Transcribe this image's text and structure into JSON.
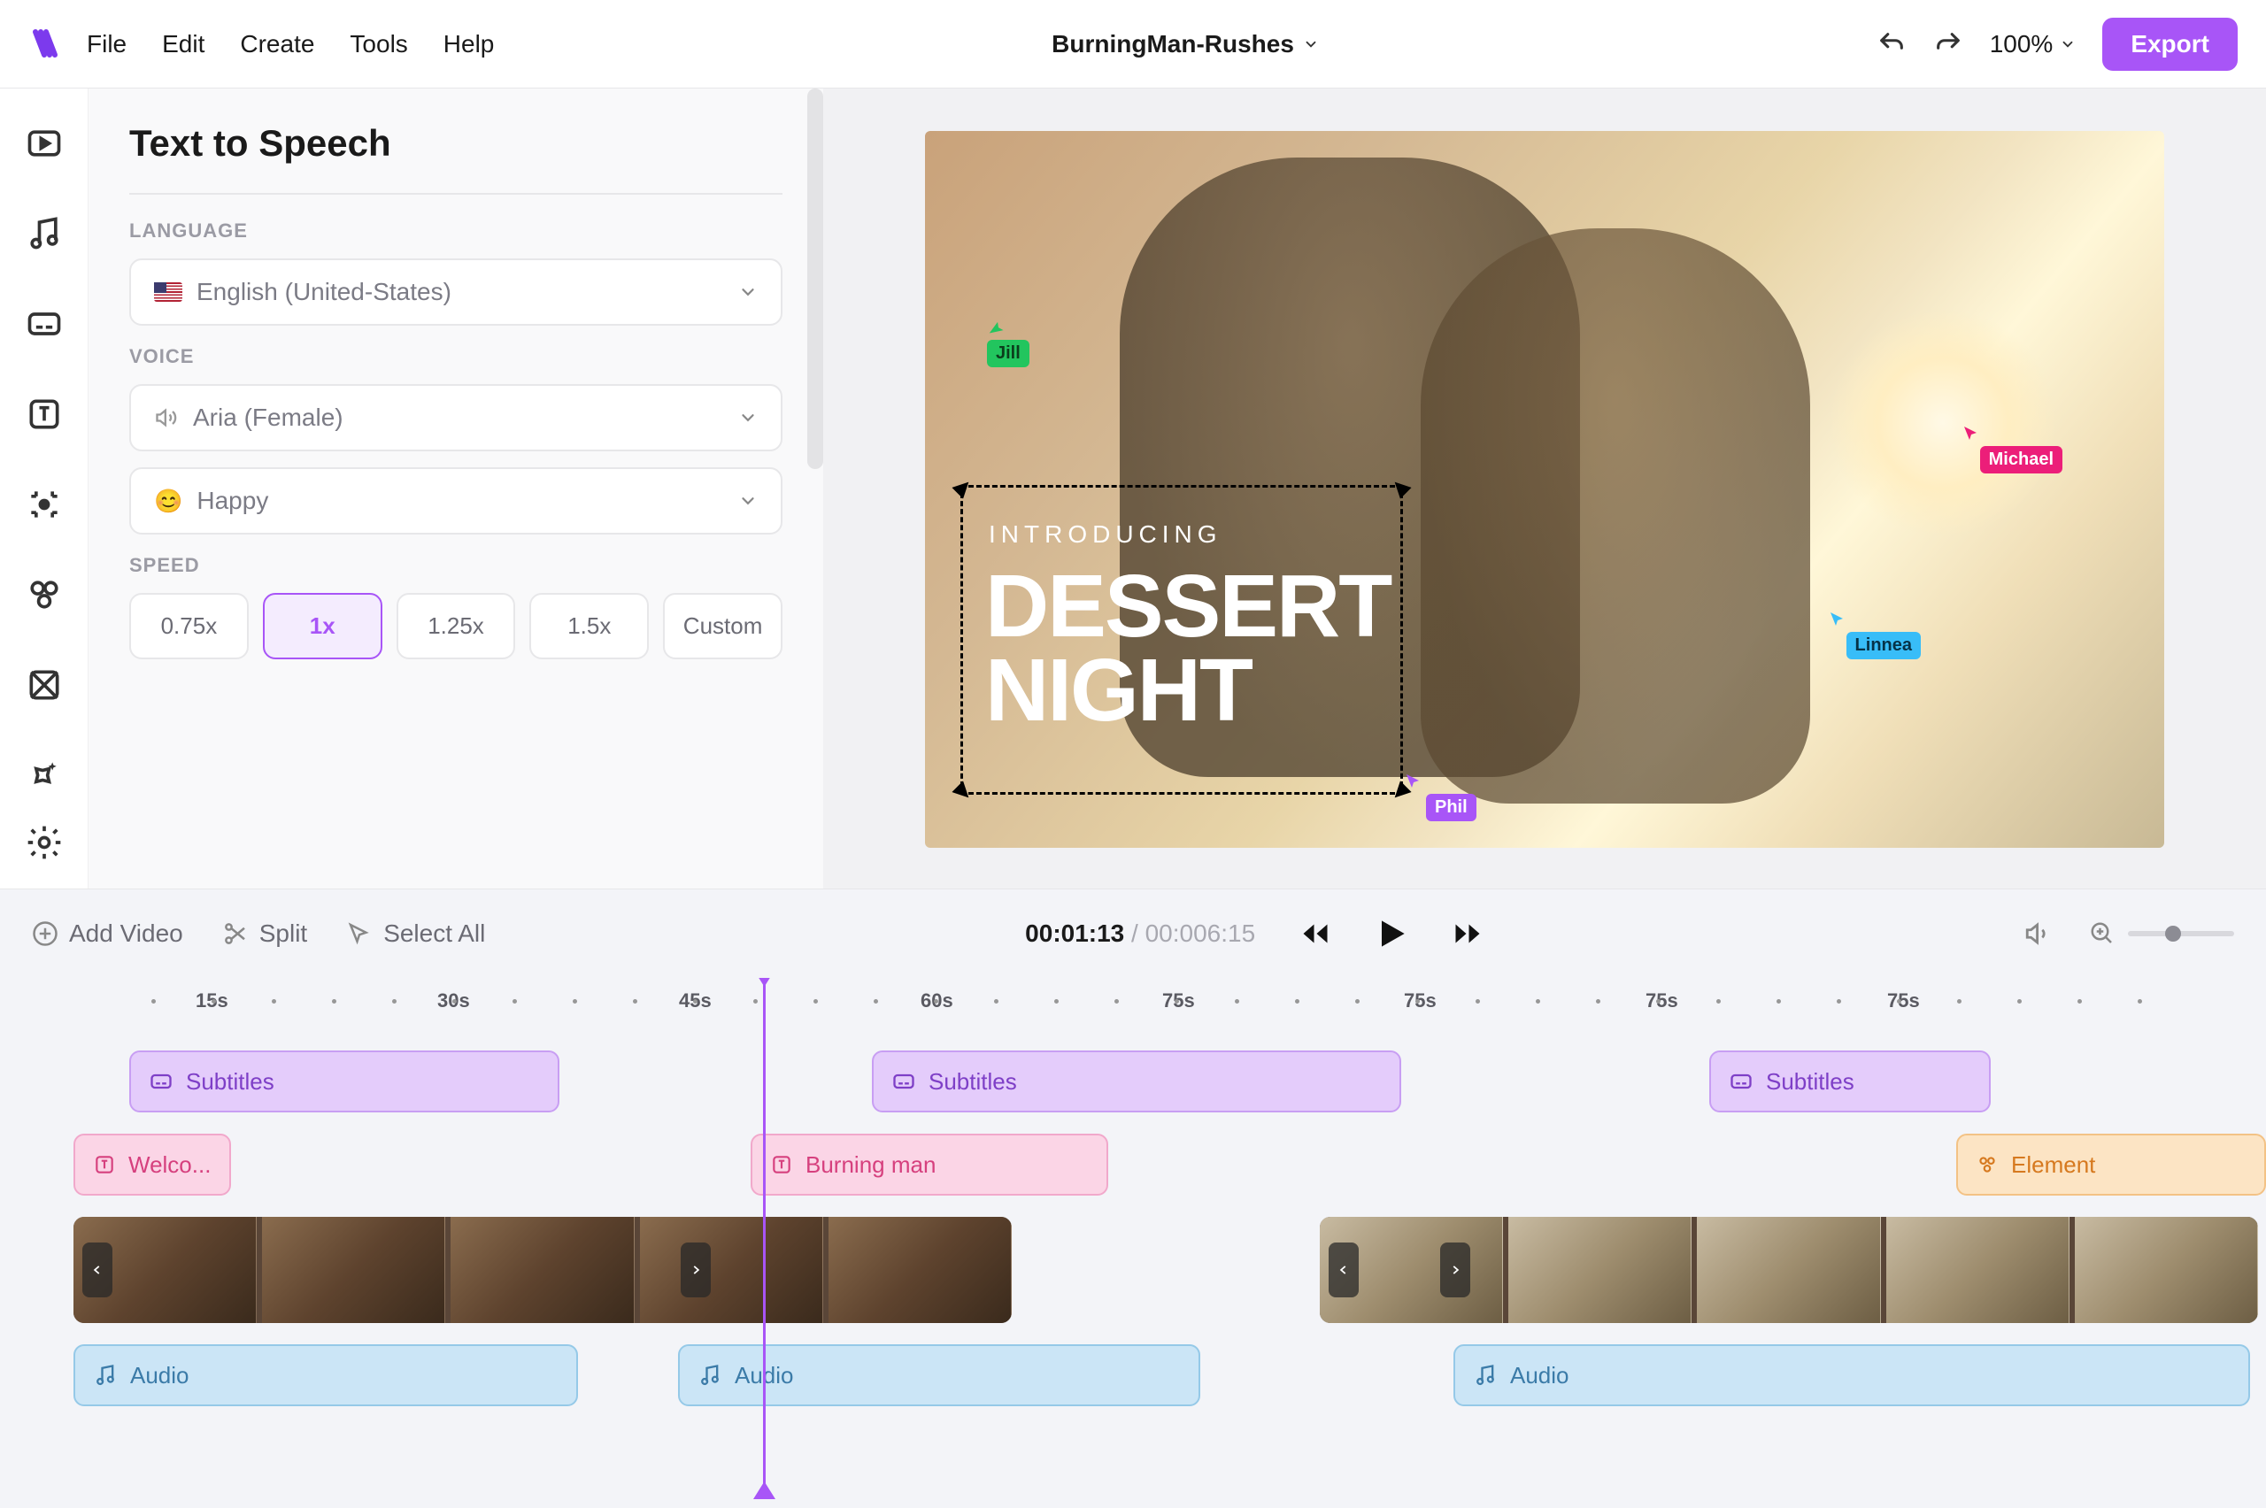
{
  "topbar": {
    "menu": [
      "File",
      "Edit",
      "Create",
      "Tools",
      "Help"
    ],
    "project": "BurningMan-Rushes",
    "zoom": "100%",
    "export": "Export"
  },
  "panel": {
    "title": "Text to Speech",
    "language_label": "Language",
    "language_value": "English (United-States)",
    "voice_label": "Voice",
    "voice_value": "Aria (Female)",
    "emotion_value": "Happy",
    "emotion_emoji": "😊",
    "speed_label": "Speed",
    "speed_options": [
      "0.75x",
      "1x",
      "1.25x",
      "1.5x",
      "Custom"
    ],
    "speed_active": "1x"
  },
  "preview": {
    "intro": "INTRODUCING",
    "title_line1": "DESSERT",
    "title_line2": "NIGHT",
    "cursors": {
      "jill": "Jill",
      "michael": "Michael",
      "linnea": "Linnea",
      "phil": "Phil"
    }
  },
  "timeline": {
    "actions": {
      "add_video": "Add Video",
      "split": "Split",
      "select_all": "Select All"
    },
    "current": "00:01:13",
    "sep": "/",
    "duration": "00:006:15",
    "ruler": [
      "15s",
      "30s",
      "45s",
      "60s",
      "75s",
      "75s",
      "75s",
      "75s"
    ],
    "subtitle_label": "Subtitles",
    "text1": "Welco...",
    "text2": "Burning man",
    "element": "Element",
    "audio": "Audio"
  }
}
